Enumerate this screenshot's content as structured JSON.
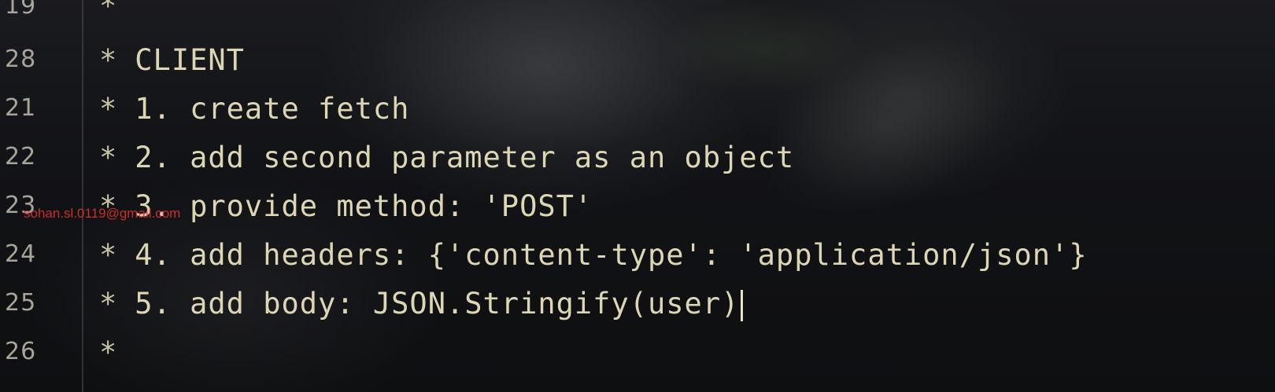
{
  "editor": {
    "lines": [
      {
        "number": "19",
        "text": "*"
      },
      {
        "number": "28",
        "text": "CLIENT"
      },
      {
        "number": "21",
        "text": "1. create fetch"
      },
      {
        "number": "22",
        "text": "2. add second parameter as an object"
      },
      {
        "number": "23",
        "text": "3. provide method: 'POST'"
      },
      {
        "number": "24",
        "text": "4. add headers: {'content-type': 'application/json'}"
      },
      {
        "number": "25",
        "text": "5. add body: JSON.Stringify(user)"
      },
      {
        "number": "26",
        "text": ""
      }
    ],
    "comment_marker": "*"
  },
  "watermark": "sohan.sl.0119@gmail.com",
  "colors": {
    "background": "#121316",
    "code_text": "#ddd6b4",
    "line_number": "#a8a49a",
    "watermark": "#e03030"
  }
}
